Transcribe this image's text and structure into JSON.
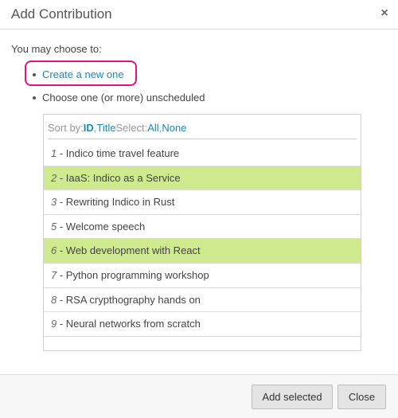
{
  "dialog": {
    "title": "Add Contribution",
    "close_glyph": "×"
  },
  "intro": "You may choose to:",
  "options": {
    "create_link": "Create a new one",
    "choose_text": "Choose one (or more) unscheduled"
  },
  "sort": {
    "prefix": "Sort by:",
    "id": "ID",
    "comma": ",",
    "title": "Title",
    "select_prefix": "Select:",
    "all": "All",
    "comma2": ",",
    "none": "None"
  },
  "contributions": [
    {
      "num": "1",
      "title": "Indico time travel feature",
      "selected": false
    },
    {
      "num": "2",
      "title": "IaaS: Indico as a Service",
      "selected": true
    },
    {
      "num": "3",
      "title": "Rewriting Indico in Rust",
      "selected": false
    },
    {
      "num": "5",
      "title": "Welcome speech",
      "selected": false
    },
    {
      "num": "6",
      "title": "Web development with React",
      "selected": true
    },
    {
      "num": "7",
      "title": "Python programming workshop",
      "selected": false
    },
    {
      "num": "8",
      "title": "RSA crypthography hands on",
      "selected": false
    },
    {
      "num": "9",
      "title": "Neural networks from scratch",
      "selected": false
    }
  ],
  "row_separator": " - ",
  "buttons": {
    "add_selected": "Add selected",
    "close": "Close"
  },
  "colors": {
    "link": "#1b8ab8",
    "selected_row": "#cfe98f",
    "highlight_ring": "#e0147c"
  }
}
